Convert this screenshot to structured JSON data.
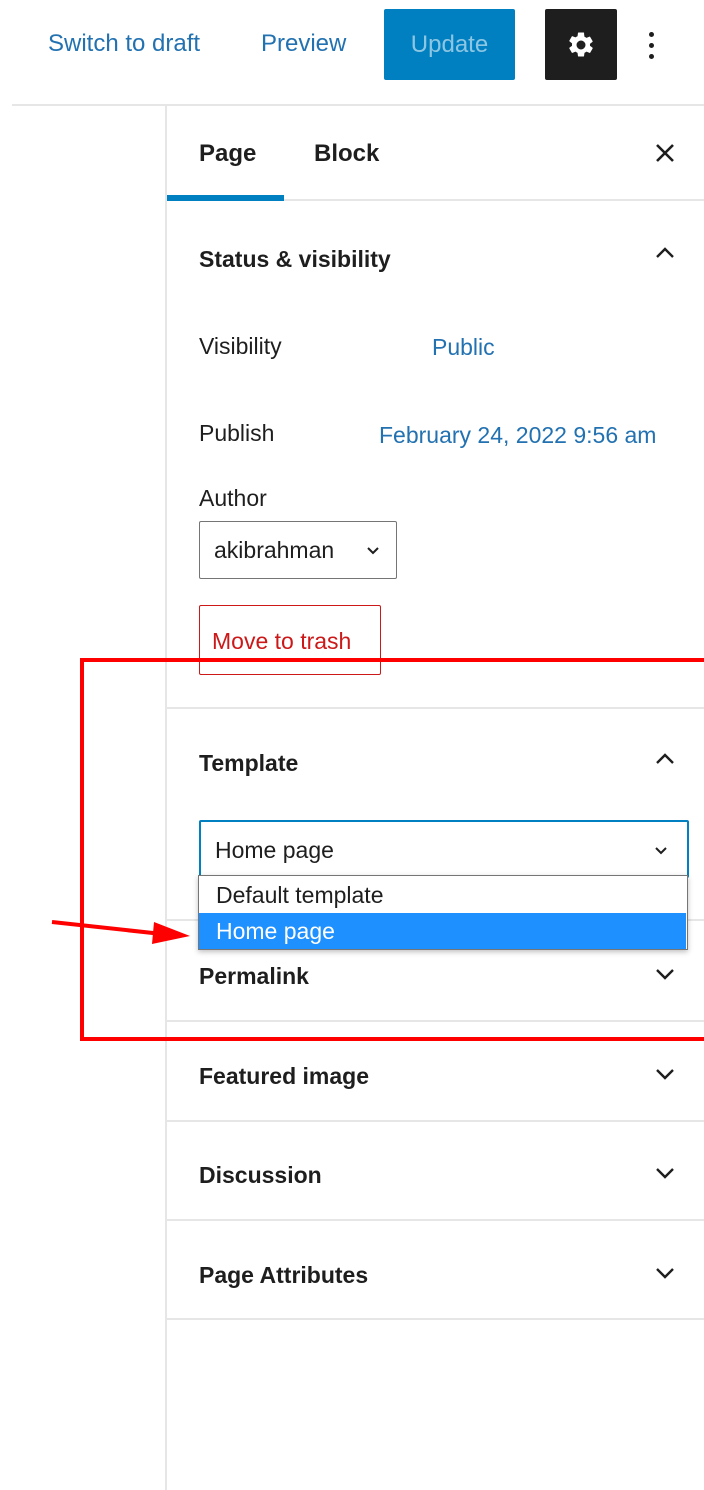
{
  "toolbar": {
    "switch_to_draft": "Switch to draft",
    "preview": "Preview",
    "update": "Update",
    "settings_icon": "gear-icon",
    "more_icon": "vertical-ellipsis-icon"
  },
  "sidebar": {
    "tabs": [
      {
        "label": "Page",
        "active": true
      },
      {
        "label": "Block",
        "active": false
      }
    ],
    "close_icon": "close-icon",
    "status_visibility": {
      "title": "Status & visibility",
      "expanded": true,
      "visibility_label": "Visibility",
      "visibility_value": "Public",
      "publish_label": "Publish",
      "publish_value": "February 24, 2022 9:56 am",
      "author_label": "Author",
      "author_value": "akibrahman",
      "trash_label": "Move to trash"
    },
    "template": {
      "title": "Template",
      "expanded": true,
      "selected": "Home page",
      "options": [
        "Default template",
        "Home page"
      ],
      "highlighted_option": "Home page"
    },
    "collapsed_sections": [
      {
        "title": "Permalink"
      },
      {
        "title": "Featured image"
      },
      {
        "title": "Discussion"
      },
      {
        "title": "Page Attributes"
      }
    ]
  },
  "colors": {
    "accent": "#0080c1",
    "link": "#2271b1",
    "danger": "#cc1818",
    "option_highlight": "#1e90ff",
    "annotation": "#ff0000"
  }
}
